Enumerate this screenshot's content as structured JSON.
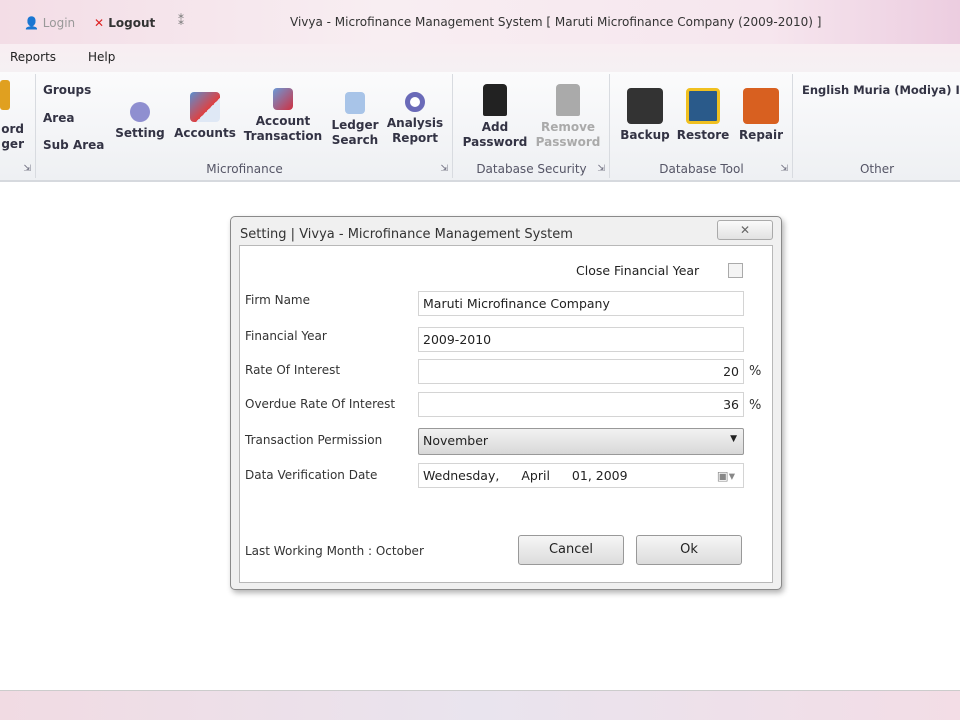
{
  "titlebar": {
    "login": "Login",
    "logout": "Logout",
    "title": "Vivya - Microfinance Management System  [ Maruti Microfinance Company   (2009-2010) ]"
  },
  "menu": {
    "reports": "Reports",
    "help": "Help"
  },
  "ribbon": {
    "partial": {
      "line1": "ord",
      "line2": "ger"
    },
    "microfinance": {
      "label": "Microfinance",
      "groups": "Groups",
      "area": "Area",
      "sub_area": "Sub Area",
      "setting": "Setting",
      "accounts": "Accounts",
      "account_transaction": [
        "Account",
        "Transaction"
      ],
      "ledger_search": [
        "Ledger",
        "Search"
      ],
      "analysis_report": [
        "Analysis",
        "Report"
      ]
    },
    "database_security": {
      "label": "Database Security",
      "add_password": [
        "Add",
        "Password"
      ],
      "remove_password": [
        "Remove",
        "Password"
      ]
    },
    "database_tool": {
      "label": "Database Tool",
      "backup": "Backup",
      "restore": "Restore",
      "repair": "Repair"
    },
    "other": {
      "label": "Other",
      "language": "English Muria (Modiya) I"
    }
  },
  "dialog": {
    "title": "Setting | Vivya - Microfinance Management System",
    "close_financial_year": "Close Financial Year",
    "close_financial_year_checked": false,
    "firm_name_label": "Firm Name",
    "firm_name": "Maruti Microfinance Company",
    "financial_year_label": "Financial Year",
    "financial_year": "2009-2010",
    "rate_label": "Rate Of Interest",
    "rate": "20",
    "pct": "%",
    "overdue_label": "Overdue Rate Of Interest",
    "overdue": "36",
    "permission_label": "Transaction Permission",
    "permission": "November",
    "date_label": "Data Verification Date",
    "date_day": "Wednesday,",
    "date_month": "April",
    "date_rest": "01, 2009",
    "last_working": "Last Working Month : October",
    "cancel": "Cancel",
    "ok": "Ok"
  }
}
